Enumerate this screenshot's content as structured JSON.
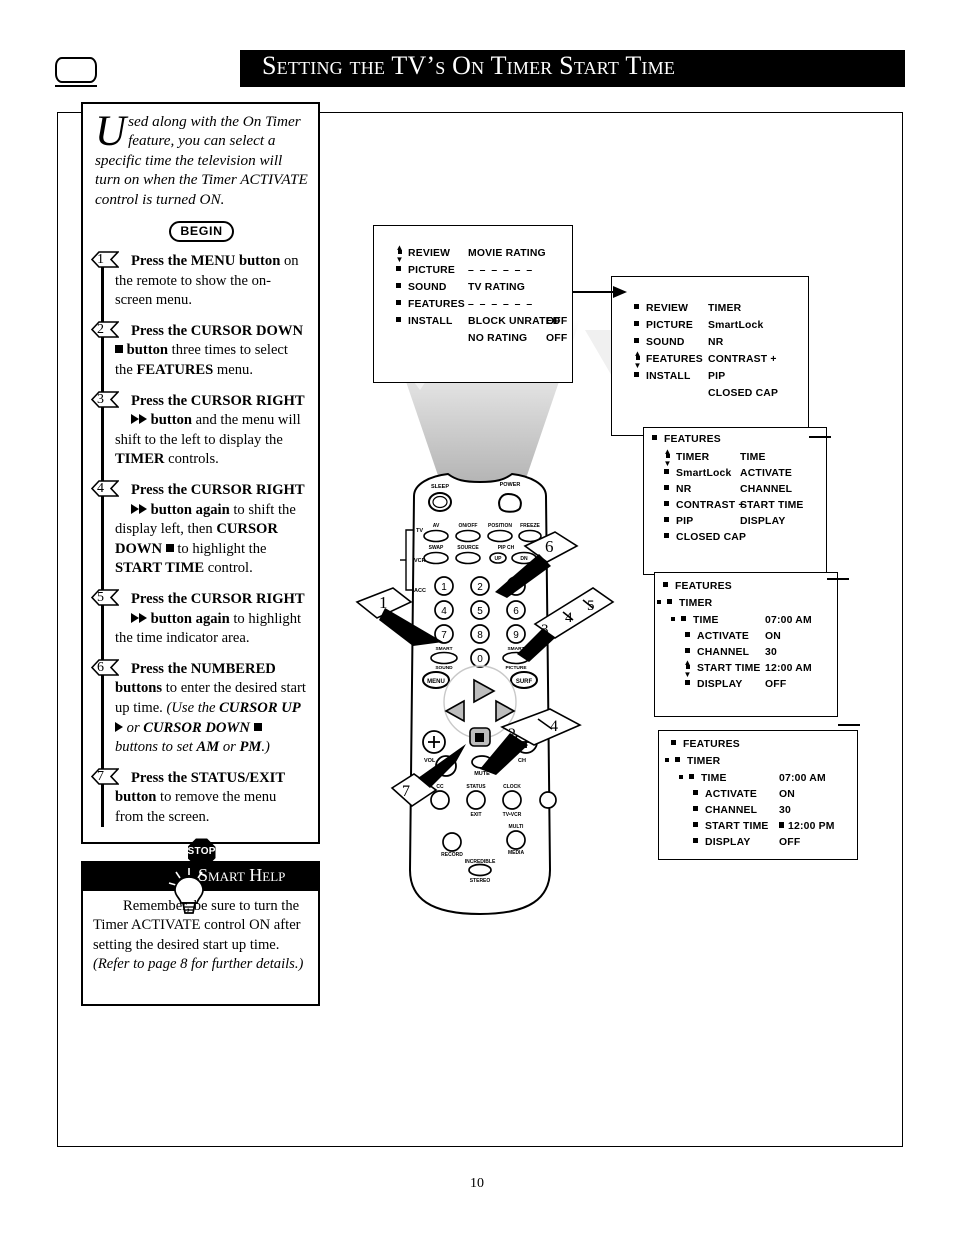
{
  "header": {
    "title": "Setting the TV’s On Timer Start Time",
    "tv_icon": "tv-screen-icon"
  },
  "intro": {
    "dropcap": "U",
    "text": "sed along with the On Timer feature, you can select a specific time the television will turn on when the Timer ACTIVATE control is turned ON."
  },
  "begin_label": "BEGIN",
  "stop_label": "STOP",
  "steps": [
    {
      "num": "1",
      "html": "<b>Press the MENU button</b> on the remote to show the on-screen menu."
    },
    {
      "num": "2",
      "html": "<b>Press the CURSOR DOWN <span class=\"sq\"></span> button</b> three times to select the <b>FEATURES</b> menu."
    },
    {
      "num": "3",
      "html": "<b>Press the CURSOR RIGHT <span class=\"dbl\"><span class=\"tri\"></span><span class=\"tri\"></span></span> button</b> and the menu will shift to the left to display the <b>TIMER</b> controls."
    },
    {
      "num": "4",
      "html": "<b>Press the CURSOR RIGHT <span class=\"dbl\"><span class=\"tri\"></span><span class=\"tri\"></span></span> button again</b> to shift the display left, then <b>CURSOR DOWN <span class=\"sq\"></span></b> to highlight the <b>START TIME</b> control."
    },
    {
      "num": "5",
      "html": "<b>Press the CURSOR RIGHT <span class=\"dbl\"><span class=\"tri\"></span><span class=\"tri\"></span></span> button again</b> to highlight the time indicator area."
    },
    {
      "num": "6",
      "html": "<b>Press the NUMBERED buttons</b> to enter the desired start up time. <i>(Use the <b>CURSOR UP <span class=\"tri\"></span></b> or <b>CURSOR DOWN <span class=\"sq\"></span></b> buttons to set <b>AM</b> or <b>PM</b>.)</i>"
    },
    {
      "num": "7",
      "html": "<b>Press the STATUS/EXIT button</b> to remove the menu from the screen."
    }
  ],
  "smart_help": {
    "title": "Smart Help",
    "icon": "light-bulb-icon",
    "text": "Remember, be sure to turn the Timer ACTIVATE control ON after setting the desired start up time. <i>(Refer to page 8 for further details.)</i>"
  },
  "osd_menus": [
    {
      "id": "osd1",
      "left_items": [
        "REVIEW",
        "PICTURE",
        "SOUND",
        "FEATURES",
        "INSTALL"
      ],
      "right_items": [
        {
          "label": "MOVIE RATING",
          "value": ""
        },
        {
          "label": "– – – – – –",
          "value": ""
        },
        {
          "label": "TV RATING",
          "value": ""
        },
        {
          "label": "– – – – – –",
          "value": ""
        },
        {
          "label": "BLOCK UNRATED",
          "value": "OFF"
        },
        {
          "label": "NO RATING",
          "value": "OFF"
        }
      ],
      "cursor_row": 0
    },
    {
      "id": "osd2",
      "left_items": [
        "REVIEW",
        "PICTURE",
        "SOUND",
        "FEATURES",
        "INSTALL"
      ],
      "right_items": [
        {
          "label": "TIMER",
          "value": ""
        },
        {
          "label": "SmartLock",
          "value": ""
        },
        {
          "label": "NR",
          "value": ""
        },
        {
          "label": "CONTRAST +",
          "value": ""
        },
        {
          "label": "PIP",
          "value": ""
        },
        {
          "label": "CLOSED CAP",
          "value": ""
        }
      ],
      "cursor_row": 3
    },
    {
      "id": "osd3",
      "header": "FEATURES",
      "left_items": [
        "TIMER",
        "SmartLock",
        "NR",
        "CONTRAST +",
        "PIP",
        "CLOSED CAP"
      ],
      "right_items": [
        {
          "label": "TIME",
          "value": ""
        },
        {
          "label": "ACTIVATE",
          "value": ""
        },
        {
          "label": "CHANNEL",
          "value": ""
        },
        {
          "label": "START TIME",
          "value": ""
        },
        {
          "label": "DISPLAY",
          "value": ""
        }
      ],
      "cursor_row": 0
    },
    {
      "id": "osd4",
      "header": "FEATURES",
      "sub_header": "TIMER",
      "rows": [
        {
          "label": "TIME",
          "value": "07:00 AM"
        },
        {
          "label": "ACTIVATE",
          "value": "ON"
        },
        {
          "label": "CHANNEL",
          "value": "30"
        },
        {
          "label": "START TIME",
          "value": "12:00 AM"
        },
        {
          "label": "DISPLAY",
          "value": "OFF"
        }
      ],
      "cursor_row": 3
    },
    {
      "id": "osd5",
      "header": "FEATURES",
      "sub_header": "TIMER",
      "rows": [
        {
          "label": "TIME",
          "value": "07:00 AM"
        },
        {
          "label": "ACTIVATE",
          "value": "ON"
        },
        {
          "label": "CHANNEL",
          "value": "30"
        },
        {
          "label": "START TIME",
          "value": "12:00 PM"
        },
        {
          "label": "DISPLAY",
          "value": "OFF"
        }
      ],
      "value_cursor_row": 3
    }
  ],
  "remote": {
    "top_buttons": [
      {
        "label": "SLEEP"
      },
      {
        "label": "POWER"
      }
    ],
    "row1": [
      "AV",
      "ON/OFF",
      "POSITION",
      "FREEZE"
    ],
    "row2": [
      "SWAP",
      "SOURCE",
      "PIP CH",
      ""
    ],
    "row2_sub": [
      "",
      "",
      "UP",
      "DN"
    ],
    "side_labels": [
      "TV",
      "VCR",
      "ACC"
    ],
    "keypad": [
      "1",
      "2",
      "3",
      "4",
      "5",
      "6",
      "7",
      "8",
      "9",
      "0"
    ],
    "smart_sound": "SMART SOUND",
    "smart_picture": "SMART PICTURE",
    "menu": "MENU",
    "surf": "SURF",
    "vol": "VOL",
    "ch": "CH",
    "mute": "MUTE",
    "cc": "CC",
    "status_exit": "STATUS EXIT",
    "clock_tvvcr": "CLOCK TV•VCR",
    "record": "RECORD",
    "multi_media": "MULTI MEDIA",
    "incredible_stereo": "INCREDIBLE STEREO"
  },
  "callouts": [
    "1",
    "2",
    "3",
    "4",
    "5",
    "6",
    "7"
  ],
  "page_number": "10"
}
